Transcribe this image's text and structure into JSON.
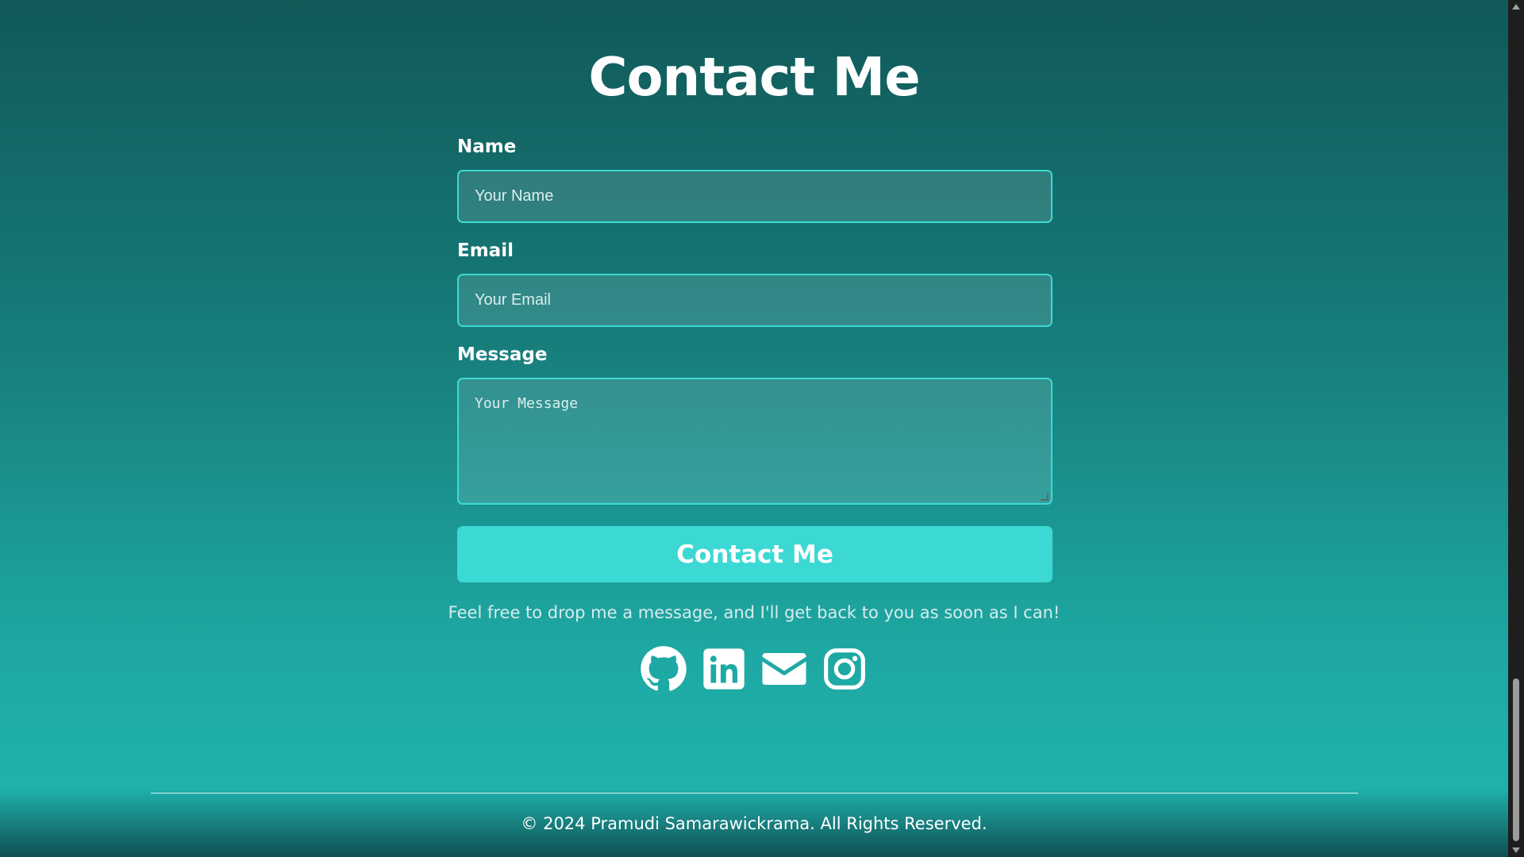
{
  "page": {
    "title": "Contact Me"
  },
  "form": {
    "name": {
      "label": "Name",
      "placeholder": "Your Name"
    },
    "email": {
      "label": "Email",
      "placeholder": "Your Email"
    },
    "message": {
      "label": "Message",
      "placeholder": "Your Message"
    },
    "submit_label": "Contact Me"
  },
  "note": "Feel free to drop me a message, and I'll get back to you as soon as I can!",
  "socials": [
    {
      "icon": "github-icon"
    },
    {
      "icon": "linkedin-icon"
    },
    {
      "icon": "email-icon"
    },
    {
      "icon": "instagram-icon"
    }
  ],
  "footer": {
    "text": "© 2024 Pramudi Samarawickrama. All Rights Reserved."
  },
  "colors": {
    "accent": "#3cd9d4",
    "background_top": "#105958",
    "background_bottom": "#1fb2ad",
    "text": "#ffffff"
  }
}
